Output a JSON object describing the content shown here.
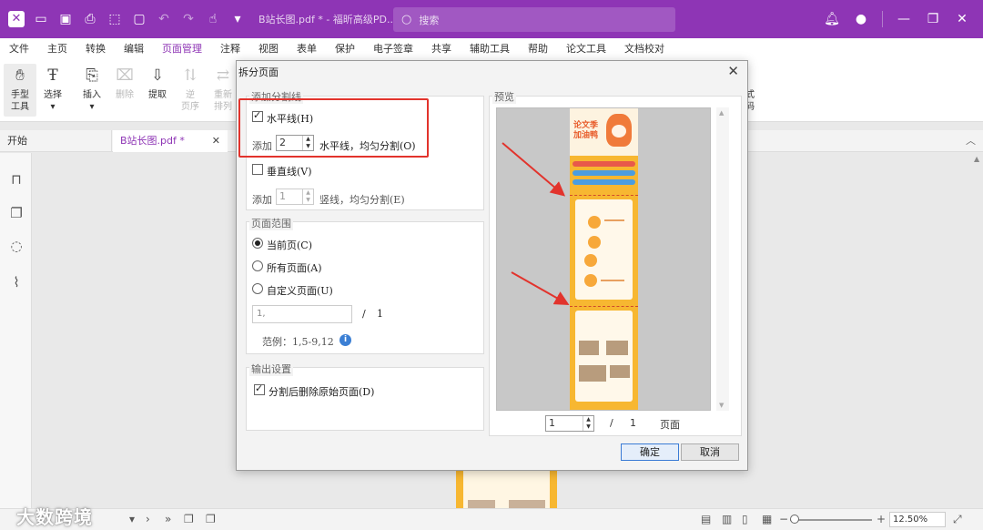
{
  "titlebar": {
    "filename": "B站长图.pdf * - 福昕高级PD...",
    "search_placeholder": "搜索"
  },
  "menu": [
    "文件",
    "主页",
    "转换",
    "编辑",
    "页面管理",
    "注释",
    "视图",
    "表单",
    "保护",
    "电子签章",
    "共享",
    "辅助工具",
    "帮助",
    "论文工具",
    "文档校对"
  ],
  "ribbon": {
    "hand": [
      "手型",
      "工具"
    ],
    "select": "选择",
    "insert": "插入",
    "delete": "删除",
    "extract": "提取",
    "reverse": [
      "逆",
      "页序"
    ],
    "rearrange": [
      "重新",
      "排列"
    ],
    "right_partial": [
      "式",
      "码"
    ]
  },
  "tabs": {
    "home": "开始",
    "doc": "B站长图.pdf *"
  },
  "statusbar": {
    "zoom": "12.50%",
    "watermark": "大数跨境"
  },
  "dialog": {
    "title": "拆分页面",
    "add_lines_group": "添加分割线",
    "horizontal_label": "水平线(H)",
    "horizontal_checked": true,
    "add_prefix": "添加",
    "horizontal_count": "2",
    "horizontal_suffix": "水平线，均匀分割(O)",
    "vertical_label": "垂直线(V)",
    "vertical_checked": false,
    "vertical_count": "1",
    "vertical_suffix": "竖线，均匀分割(E)",
    "range_group": "页面范围",
    "current_page": "当前页(C)",
    "all_pages": "所有页面(A)",
    "custom_pages": "自定义页面(U)",
    "range_value": "1,",
    "range_slash": "/",
    "range_total": "1",
    "example": "范例：1,5-9,12",
    "output_group": "输出设置",
    "delete_original": "分割后删除原始页面(D)",
    "delete_original_checked": true,
    "preview_group": "预览",
    "preview_page": "1",
    "preview_slash": "/",
    "preview_total": "1",
    "preview_unit": "页面",
    "ok": "确定",
    "cancel": "取消",
    "poster_title": [
      "论文季",
      "加油鸭"
    ]
  },
  "colors": {
    "brand": "#8e35b5",
    "annotation": "#e2332c"
  }
}
